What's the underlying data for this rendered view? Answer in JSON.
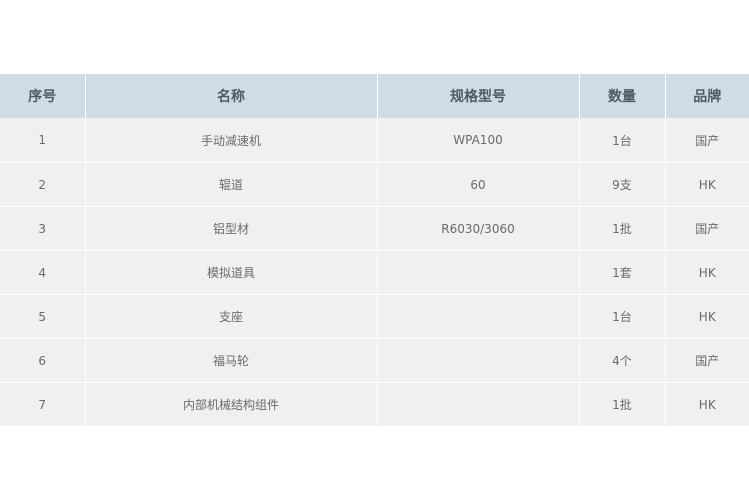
{
  "table": {
    "headers": [
      "序号",
      "名称",
      "规格型号",
      "数量",
      "品牌"
    ],
    "rows": [
      [
        "1",
        "手动减速机",
        "WPA100",
        "1台",
        "国产"
      ],
      [
        "2",
        "辊道",
        "60",
        "9支",
        "HK"
      ],
      [
        "3",
        "铝型材",
        "R6030/3060",
        "1批",
        "国产"
      ],
      [
        "4",
        "模拟道具",
        "",
        "1套",
        "HK"
      ],
      [
        "5",
        "支座",
        "",
        "1台",
        "HK"
      ],
      [
        "6",
        "福马轮",
        "",
        "4个",
        "国产"
      ],
      [
        "7",
        "内部机械结构组件",
        "",
        "1批",
        "HK"
      ]
    ]
  }
}
